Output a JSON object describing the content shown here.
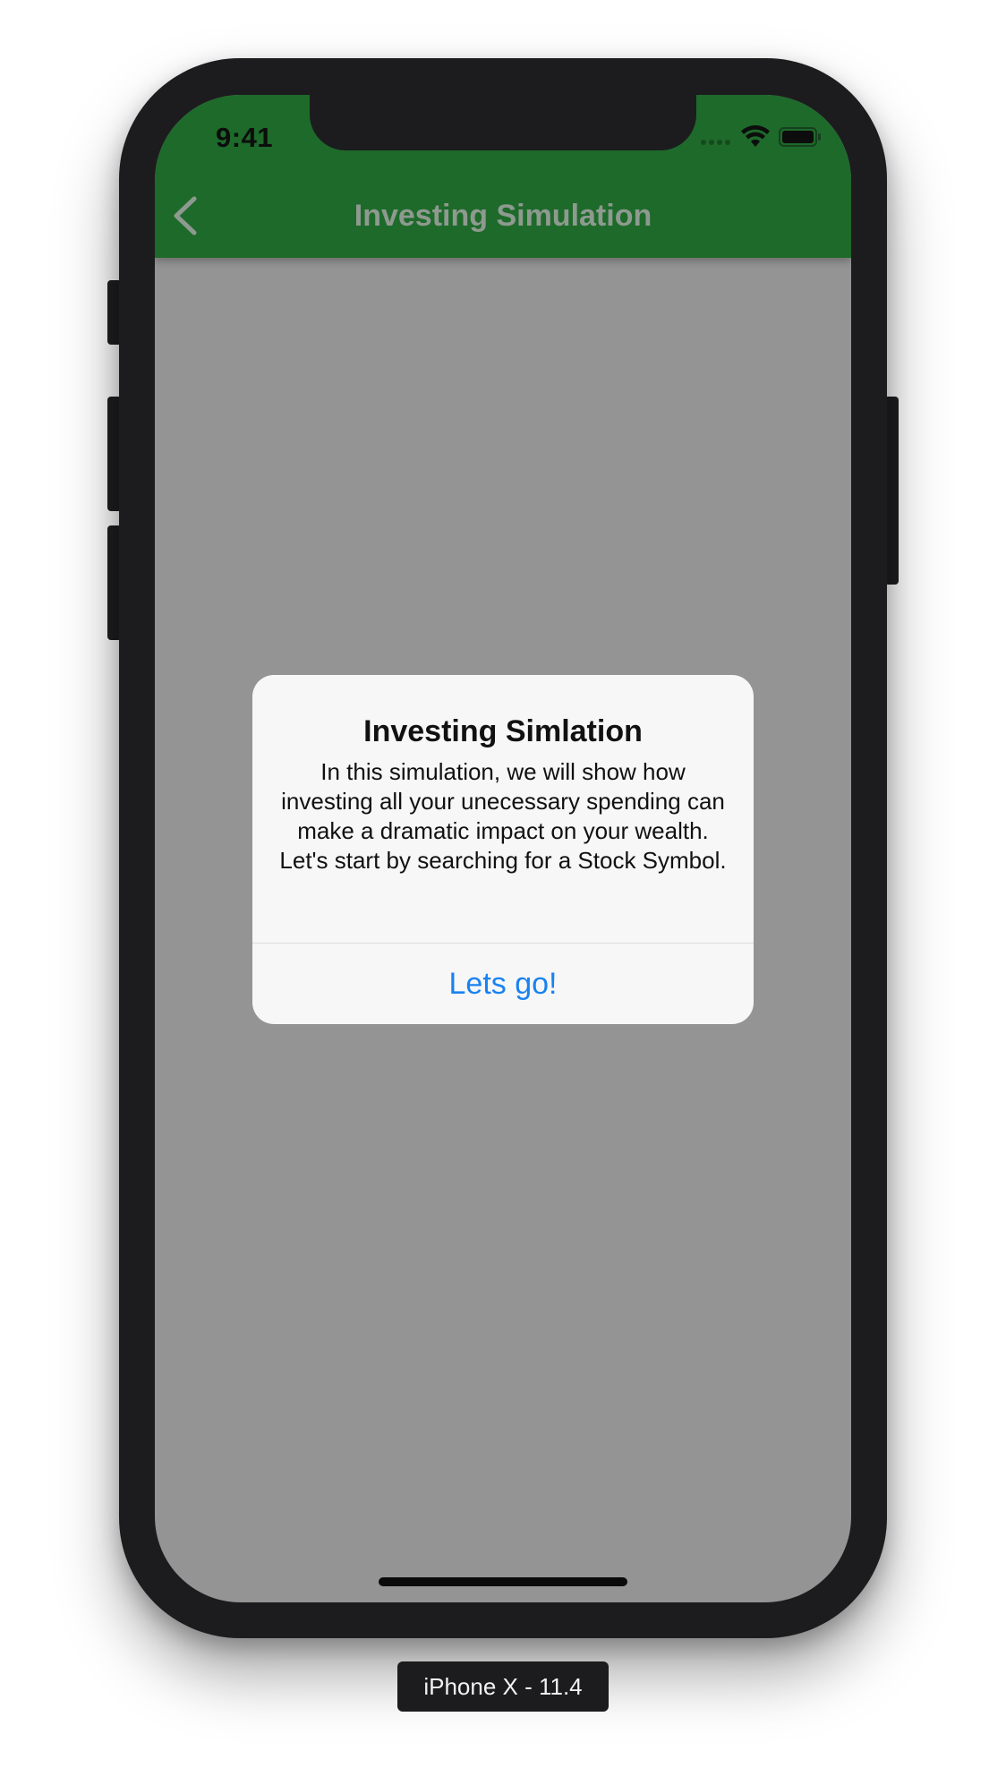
{
  "status_bar": {
    "time": "9:41",
    "icons": [
      "signal-dots-icon",
      "wifi-icon",
      "battery-icon"
    ]
  },
  "navbar": {
    "back_icon": "chevron-left-icon",
    "title": "Investing Simulation",
    "background": "#1e6a2b",
    "title_color": "#8e9a8f"
  },
  "alert": {
    "title": "Investing Simlation",
    "message": "In this simulation, we will show how investing all your unecessary spending can make a dramatic impact on your wealth. Let's start by searching for a Stock Symbol.",
    "action_label": "Lets go!",
    "action_color": "#1a82f0"
  },
  "device_label": "iPhone X - 11.4",
  "colors": {
    "overlay": "#949494",
    "device_frame": "#1c1c1e"
  }
}
